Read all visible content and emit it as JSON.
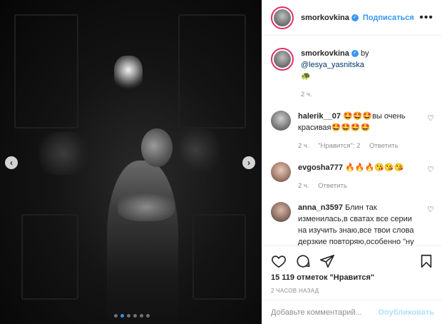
{
  "post": {
    "username": "smorkovkina",
    "follow_label": "Подписаться",
    "more_label": "•••",
    "caption_by": "by",
    "caption_mention": "@lesya_yasnitska",
    "caption_emoji": "🐢",
    "caption_time": "2 ч.",
    "likes": "15 119 отметок \"Нравится\"",
    "posted_ago": "2 часов назад",
    "comment_placeholder": "Добавьте комментарий...",
    "publish_label": "Опубликовать",
    "carousel_dots": 6,
    "carousel_active": 1
  },
  "comments": [
    {
      "username": "halerik__07",
      "text": "🤩🤩🤩вы очень красивая🤩🤩🤩🤩",
      "time": "2 ч.",
      "likes": "\"Нравится\": 2",
      "reply": "Ответить"
    },
    {
      "username": "evgosha777",
      "text": "🔥🔥🔥😘😘😘",
      "time": "2 ч.",
      "reply": "Ответить"
    },
    {
      "username": "anna_n3597",
      "text": "Блин так изменилась,в сватах все серии на изучить знаю,все твои слова дерзкие повторяю,особенно \"ну да ну да какое тело такой и хранитель\".\"дет.а можно"
    }
  ],
  "icons": {
    "like": "heart-icon",
    "comment": "comment-icon",
    "share": "share-icon",
    "save": "bookmark-icon",
    "verified": "verified-icon"
  },
  "colors": {
    "accent": "#3897f0",
    "publish_disabled": "#b2dffc",
    "muted": "#8e8e8e"
  }
}
